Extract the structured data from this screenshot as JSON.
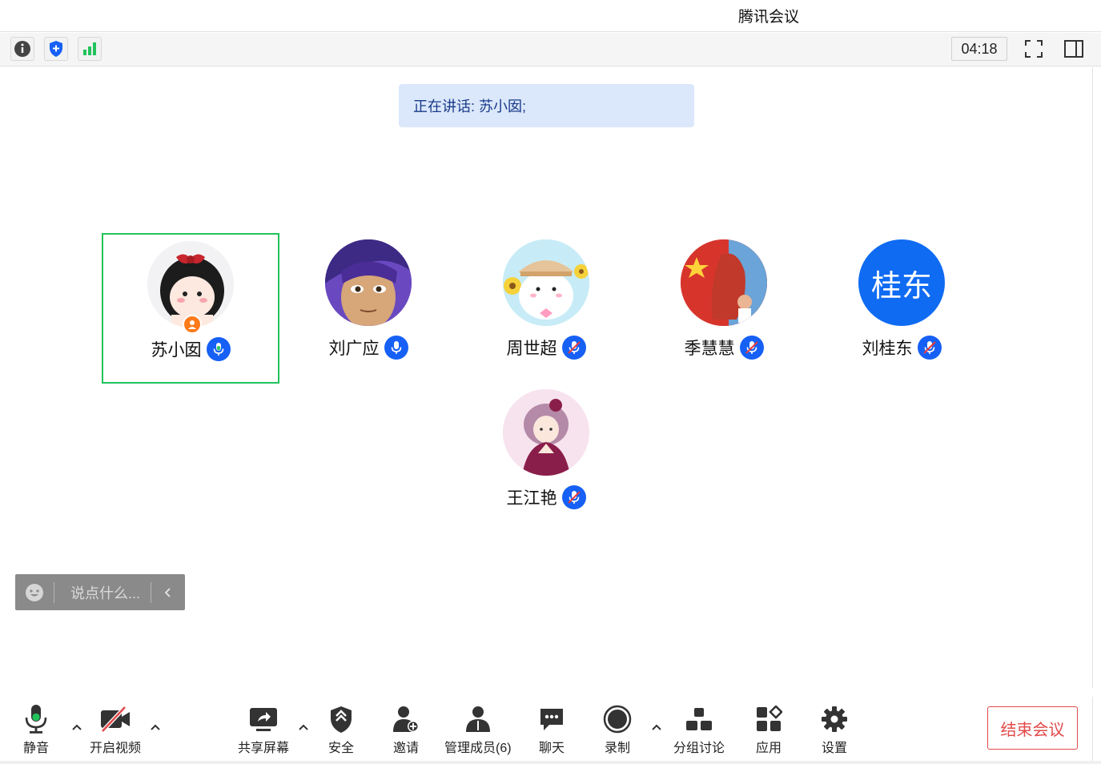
{
  "window": {
    "title": "腾讯会议"
  },
  "topbar": {
    "timer": "04:18"
  },
  "speaking": {
    "text": "正在讲话: 苏小囡;"
  },
  "participants": [
    {
      "name": "苏小囡",
      "mic": "on",
      "host": true,
      "active": true
    },
    {
      "name": "刘广应",
      "mic": "on"
    },
    {
      "name": "周世超",
      "mic": "muted"
    },
    {
      "name": "季慧慧",
      "mic": "muted"
    },
    {
      "name": "刘桂东",
      "mic": "muted",
      "avatar_text": "桂东"
    },
    {
      "name": "王江艳",
      "mic": "muted"
    }
  ],
  "chat": {
    "placeholder": "说点什么..."
  },
  "toolbar": {
    "mute": "静音",
    "video": "开启视频",
    "share": "共享屏幕",
    "security": "安全",
    "invite": "邀请",
    "members": "管理成员(6)",
    "chat": "聊天",
    "record": "录制",
    "breakout": "分组讨论",
    "apps": "应用",
    "settings": "设置",
    "end": "结束会议"
  },
  "colors": {
    "accent": "#1660f5",
    "active_border": "#22c35b",
    "end": "#e24a4a",
    "banner": "#dbe8fb"
  }
}
